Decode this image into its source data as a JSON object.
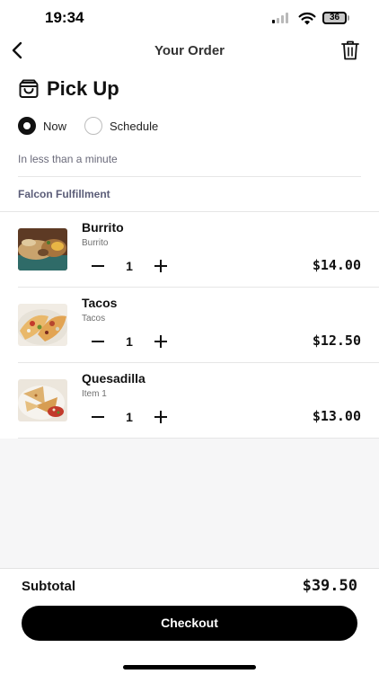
{
  "status_bar": {
    "time": "19:34",
    "battery": "36"
  },
  "nav": {
    "title": "Your Order"
  },
  "pickup": {
    "title": "Pick Up",
    "options": [
      "Now",
      "Schedule"
    ],
    "selected": "Now",
    "eta": "In less than a minute"
  },
  "fulfillment": {
    "label": "Falcon Fulfillment"
  },
  "items": [
    {
      "name": "Burrito",
      "subtitle": "Burrito",
      "qty": "1",
      "price": "$14.00"
    },
    {
      "name": "Tacos",
      "subtitle": "Tacos",
      "qty": "1",
      "price": "$12.50"
    },
    {
      "name": "Quesadilla",
      "subtitle": "Item 1",
      "qty": "1",
      "price": "$13.00"
    }
  ],
  "summary": {
    "subtotal_label": "Subtotal",
    "subtotal_value": "$39.50"
  },
  "checkout": {
    "label": "Checkout"
  },
  "colors": {
    "accent": "#000000",
    "muted_label": "#5b5d78",
    "eta_text": "#6a6a7a"
  }
}
